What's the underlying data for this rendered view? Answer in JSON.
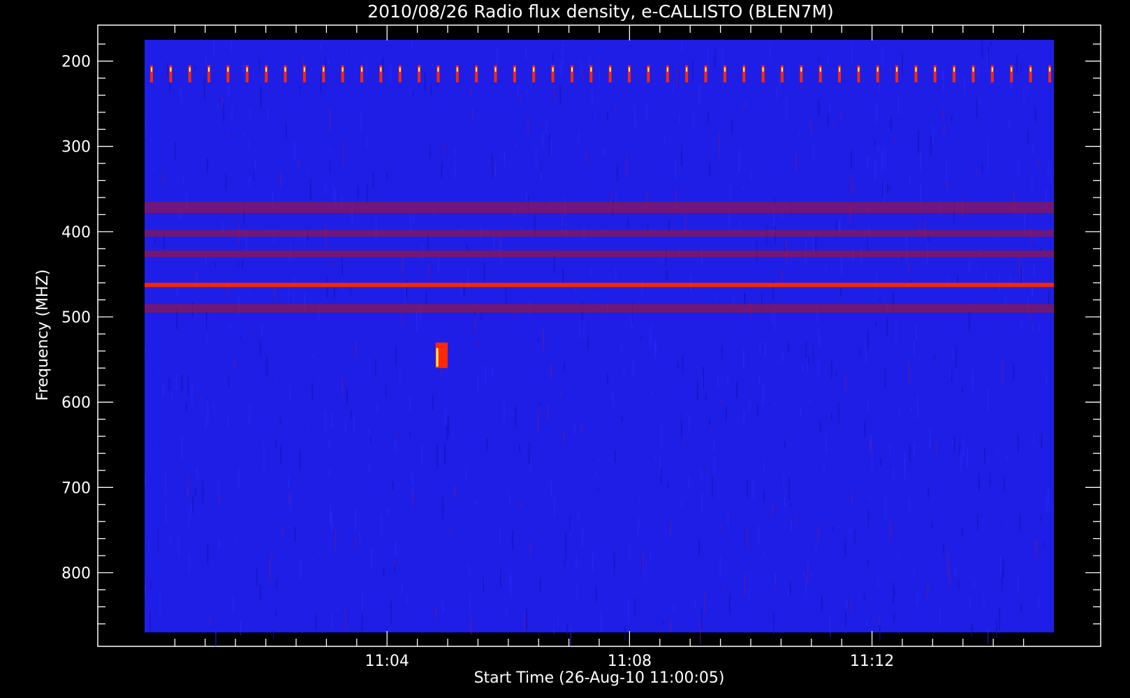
{
  "chart_data": {
    "type": "heatmap",
    "title": "2010/08/26  Radio flux density, e-CALLISTO (BLEN7M)",
    "xlabel": "Start Time (26-Aug-10 11:00:05)",
    "ylabel": "Frequency (MHZ)",
    "x_unit": "UT",
    "x_start": "11:00:05",
    "xlim_minutes": [
      0,
      15
    ],
    "x_ticks": [
      {
        "label": "11:04",
        "minutes": 4
      },
      {
        "label": "11:08",
        "minutes": 8
      },
      {
        "label": "11:12",
        "minutes": 12
      }
    ],
    "ylim": [
      870,
      175
    ],
    "y_ticks": [
      200,
      300,
      400,
      500,
      600,
      700,
      800
    ],
    "colormap": {
      "background": "#1e1ee6",
      "low": "#000060",
      "mid": "#b4141e",
      "high": "#ff2800",
      "peak": "#ffff60"
    },
    "features": [
      {
        "name": "periodic interference",
        "freq_mhz": [
          205,
          225
        ],
        "time_min": [
          0,
          15
        ],
        "intensity": "high"
      },
      {
        "name": "band 370 MHz",
        "freq_mhz": [
          365,
          378
        ],
        "time_min": [
          0,
          15
        ],
        "intensity": "mid"
      },
      {
        "name": "band 400 MHz",
        "freq_mhz": [
          398,
          406
        ],
        "time_min": [
          0,
          15
        ],
        "intensity": "mid"
      },
      {
        "name": "band 425 MHz",
        "freq_mhz": [
          422,
          430
        ],
        "time_min": [
          0,
          15
        ],
        "intensity": "mid"
      },
      {
        "name": "strong line 462 MHz",
        "freq_mhz": [
          460,
          465
        ],
        "time_min": [
          0,
          15
        ],
        "intensity": "high"
      },
      {
        "name": "band 490 MHz",
        "freq_mhz": [
          485,
          495
        ],
        "time_min": [
          0,
          15
        ],
        "intensity": "mid"
      },
      {
        "name": "burst",
        "freq_mhz": [
          530,
          560
        ],
        "time_min": [
          4.8,
          5.0
        ],
        "intensity": "peak"
      }
    ]
  }
}
